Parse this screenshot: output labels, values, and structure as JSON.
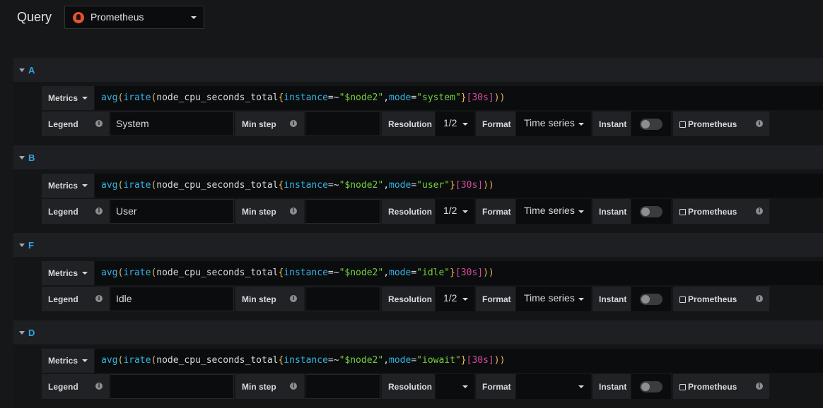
{
  "header": {
    "title": "Query",
    "datasource": "Prometheus"
  },
  "labels": {
    "metrics": "Metrics",
    "legend": "Legend",
    "min_step": "Min step",
    "resolution": "Resolution",
    "format": "Format",
    "instant": "Instant",
    "prometheus_link": "Prometheus"
  },
  "queries": [
    {
      "ref": "A",
      "expr": {
        "fn1": "avg",
        "fn2": "irate",
        "metric": "node_cpu_seconds_total",
        "l1": "instance",
        "op1": "=~",
        "v1": "\"$node2\"",
        "l2": "mode",
        "op2": "=",
        "v2": "\"system\"",
        "range": "[30s]"
      },
      "legend": "System",
      "min_step": "",
      "resolution": "1/2",
      "format": "Time series",
      "instant": false
    },
    {
      "ref": "B",
      "expr": {
        "fn1": "avg",
        "fn2": "irate",
        "metric": "node_cpu_seconds_total",
        "l1": "instance",
        "op1": "=~",
        "v1": "\"$node2\"",
        "l2": "mode",
        "op2": "=",
        "v2": "\"user\"",
        "range": "[30s]"
      },
      "legend": "User",
      "min_step": "",
      "resolution": "1/2",
      "format": "Time series",
      "instant": false
    },
    {
      "ref": "F",
      "expr": {
        "fn1": "avg",
        "fn2": "irate",
        "metric": "node_cpu_seconds_total",
        "l1": "instance",
        "op1": "=~",
        "v1": "\"$node2\"",
        "l2": "mode",
        "op2": "=",
        "v2": "\"idle\"",
        "range": "[30s]"
      },
      "legend": "Idle",
      "min_step": "",
      "resolution": "1/2",
      "format": "Time series",
      "instant": false
    },
    {
      "ref": "D",
      "expr": {
        "fn1": "avg",
        "fn2": "irate",
        "metric": "node_cpu_seconds_total",
        "l1": "instance",
        "op1": "=~",
        "v1": "\"$node2\"",
        "l2": "mode",
        "op2": "=",
        "v2": "\"iowait\"",
        "range": "[30s]"
      },
      "legend": "",
      "min_step": "",
      "resolution": "",
      "format": "",
      "instant": false
    }
  ]
}
